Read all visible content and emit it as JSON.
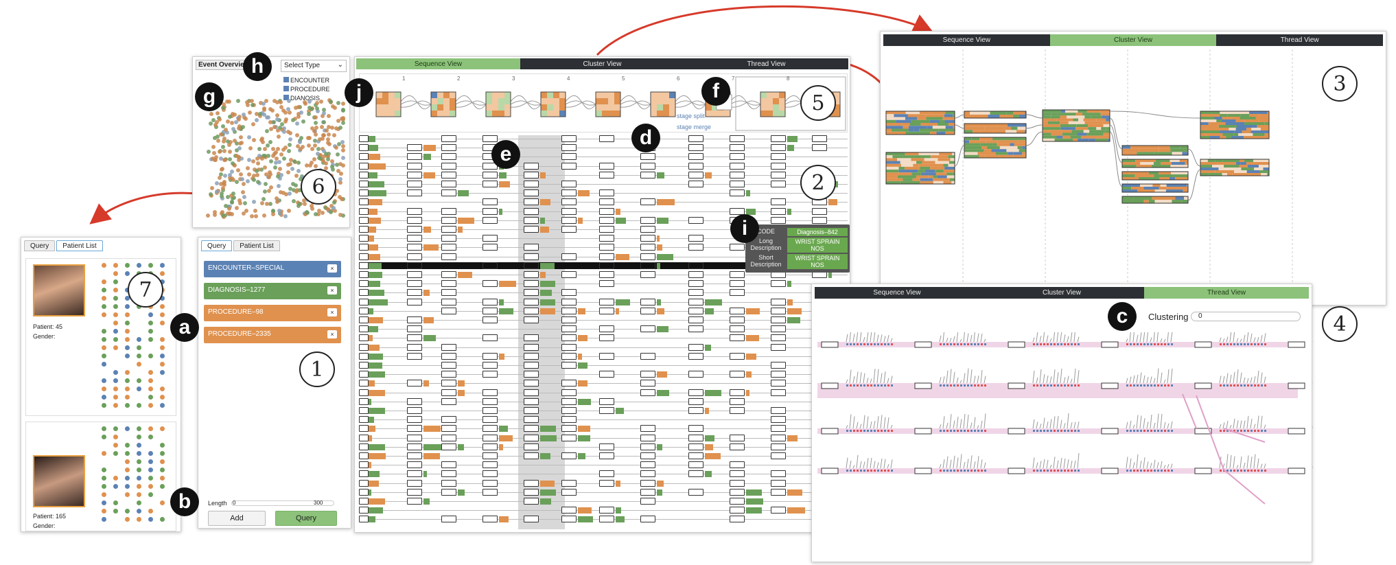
{
  "badges": {
    "a": "a",
    "b": "b",
    "c": "c",
    "d": "d",
    "e": "e",
    "f": "f",
    "g": "g",
    "h": "h",
    "i": "i",
    "j": "j"
  },
  "numbers": {
    "n1": "1",
    "n2": "2",
    "n3": "3",
    "n4": "4",
    "n5": "5",
    "n6": "6",
    "n7": "7"
  },
  "patient_panel": {
    "tabs": [
      "Query",
      "Patient List"
    ],
    "patients": [
      {
        "id_label": "Patient: 45",
        "gender_label": "Gender:"
      },
      {
        "id_label": "Patient: 165",
        "gender_label": "Gender:"
      }
    ]
  },
  "event_overview": {
    "title": "Event Overview",
    "select_label": "Select Type",
    "checkboxes": [
      "ENCOUNTER",
      "PROCEDURE",
      "DIANOSIS"
    ]
  },
  "query_panel": {
    "tabs": [
      "Query",
      "Patient List"
    ],
    "items": [
      {
        "label": "ENCOUNTER–SPECIAL",
        "color": "#5b82b4"
      },
      {
        "label": "DIAGNOSIS–1277",
        "color": "#6aa05a"
      },
      {
        "label": "PROCEDURE–98",
        "color": "#e0914e"
      },
      {
        "label": "PROCEDURE–2335",
        "color": "#e0914e"
      }
    ],
    "remove_label": "×",
    "length_label": "Length",
    "length_min": "0",
    "length_max": "300",
    "add_label": "Add",
    "query_label": "Query"
  },
  "main_view": {
    "tabs": [
      "Sequence View",
      "Cluster View",
      "Thread View"
    ],
    "active_tab": 0,
    "stage_ticks": [
      "1",
      "2",
      "3",
      "4",
      "5",
      "6",
      "7",
      "8"
    ],
    "stage_split": "stage split",
    "stage_merge": "stage merge"
  },
  "tooltip": {
    "rows": [
      {
        "k": "CODE",
        "v": "Diagnosis–842"
      },
      {
        "k": "Long Description",
        "v": "WRIST SPRAIN NOS"
      },
      {
        "k": "Short Description",
        "v": "WRIST SPRAIN NOS"
      }
    ]
  },
  "cluster_view": {
    "tabs": [
      "Sequence View",
      "Cluster View",
      "Thread View"
    ],
    "active_tab": 1
  },
  "thread_view": {
    "tabs": [
      "Sequence View",
      "Cluster View",
      "Thread View"
    ],
    "active_tab": 2,
    "clustering_label": "Clustering",
    "clustering_value": "0"
  },
  "colors": {
    "green": "#6aa05a",
    "orange": "#e0914e",
    "blue": "#5b82b4",
    "pink": "#e8b7d6",
    "dark": "#2c2f33",
    "tabgreen": "#8cc27a",
    "arrow": "#d63a2a"
  }
}
